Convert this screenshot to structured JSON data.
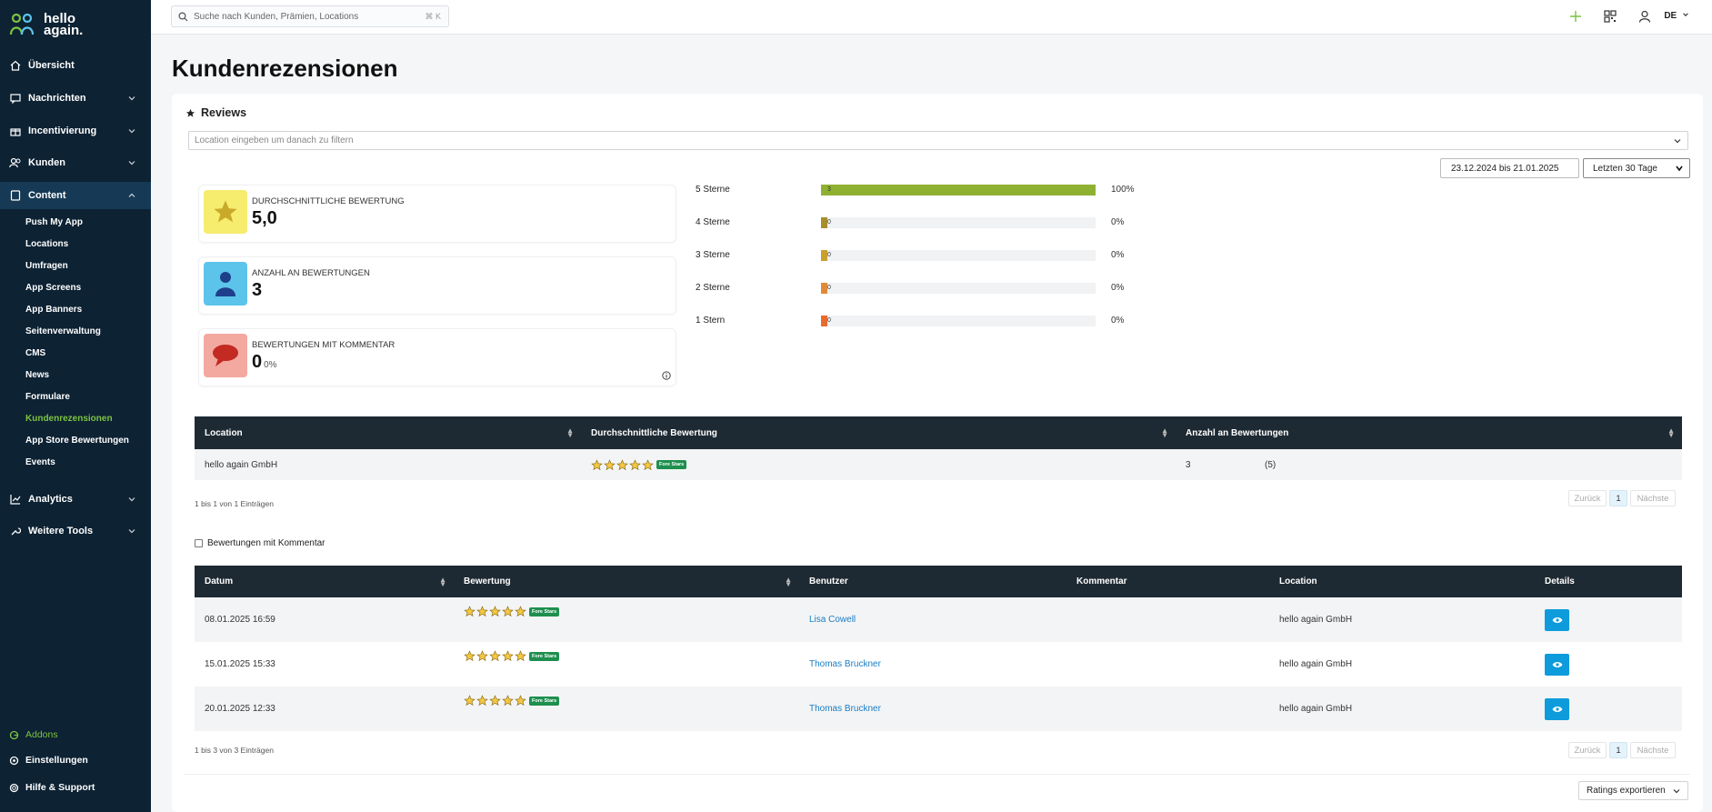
{
  "brand": {
    "line1": "hello",
    "line2": "again.",
    "accent": "#7cc242"
  },
  "nav": {
    "overview": "Übersicht",
    "messages": "Nachrichten",
    "incentives": "Incentivierung",
    "customers": "Kunden",
    "content": "Content",
    "content_items": [
      "Push My App",
      "Locations",
      "Umfragen",
      "App Screens",
      "App Banners",
      "Seitenverwaltung",
      "CMS",
      "News",
      "Formulare",
      "Kundenrezensionen",
      "App Store Bewertungen",
      "Events"
    ],
    "analytics": "Analytics",
    "tools": "Weitere Tools",
    "addons": "Addons",
    "settings": "Einstellungen",
    "help": "Hilfe & Support"
  },
  "topbar": {
    "search_placeholder": "Suche nach Kunden, Prämien, Locations",
    "shortcut": "⌘ K",
    "lang": "DE"
  },
  "page": {
    "title": "Kundenrezensionen"
  },
  "reviews": {
    "title": "Reviews",
    "location_placeholder": "Location eingeben um danach zu filtern",
    "date_range": "23.12.2024 bis 21.01.2025",
    "period": "Letzten 30 Tage",
    "stats": [
      {
        "label": "DURCHSCHNITTLICHE BEWERTUNG",
        "value": "5,0",
        "color": "#f6ec6e"
      },
      {
        "label": "ANZAHL AN BEWERTUNGEN",
        "value": "3",
        "color": "#5cc4ea"
      },
      {
        "label": "BEWERTUNGEN MIT KOMMENTAR",
        "value": "0",
        "pct": "0%",
        "color": "#f3a9a0"
      }
    ],
    "distribution": [
      {
        "label": "5 Sterne",
        "count": "3",
        "percent": "100%",
        "fraction": 1.0,
        "color": "#8fb132"
      },
      {
        "label": "4 Sterne",
        "count": "0",
        "percent": "0%",
        "fraction": 0.0,
        "color": "#a68e2a"
      },
      {
        "label": "3 Sterne",
        "count": "0",
        "percent": "0%",
        "fraction": 0.0,
        "color": "#c9a02c"
      },
      {
        "label": "2 Sterne",
        "count": "0",
        "percent": "0%",
        "fraction": 0.0,
        "color": "#e08a36"
      },
      {
        "label": "1 Stern",
        "count": "0",
        "percent": "0%",
        "fraction": 0.0,
        "color": "#e96b2c"
      }
    ]
  },
  "location_table": {
    "headers": [
      "Location",
      "Durchschnittliche Bewertung",
      "Anzahl an Bewertungen"
    ],
    "rows": [
      {
        "location": "hello again GmbH",
        "rating": 5,
        "badge": "Fore Stars",
        "count": "3",
        "count_total": "(5)"
      }
    ],
    "info": "1 bis 1 von 1 Einträgen"
  },
  "pager": {
    "prev": "Zurück",
    "page": "1",
    "next": "Nächste"
  },
  "filter": {
    "with_comment": "Bewertungen mit Kommentar"
  },
  "review_table": {
    "headers": [
      "Datum",
      "Bewertung",
      "Benutzer",
      "Kommentar",
      "Location",
      "Details"
    ],
    "rows": [
      {
        "date": "08.01.2025 16:59",
        "rating": 5,
        "badge": "Fore Stars",
        "user": "Lisa Cowell",
        "comment": "",
        "location": "hello again GmbH"
      },
      {
        "date": "15.01.2025 15:33",
        "rating": 5,
        "badge": "Fore Stars",
        "user": "Thomas Bruckner",
        "comment": "",
        "location": "hello again GmbH"
      },
      {
        "date": "20.01.2025 12:33",
        "rating": 5,
        "badge": "Fore Stars",
        "user": "Thomas Bruckner",
        "comment": "",
        "location": "hello again GmbH"
      }
    ],
    "info": "1 bis 3 von 3 Einträgen"
  },
  "export": {
    "label": "Ratings exportieren"
  }
}
